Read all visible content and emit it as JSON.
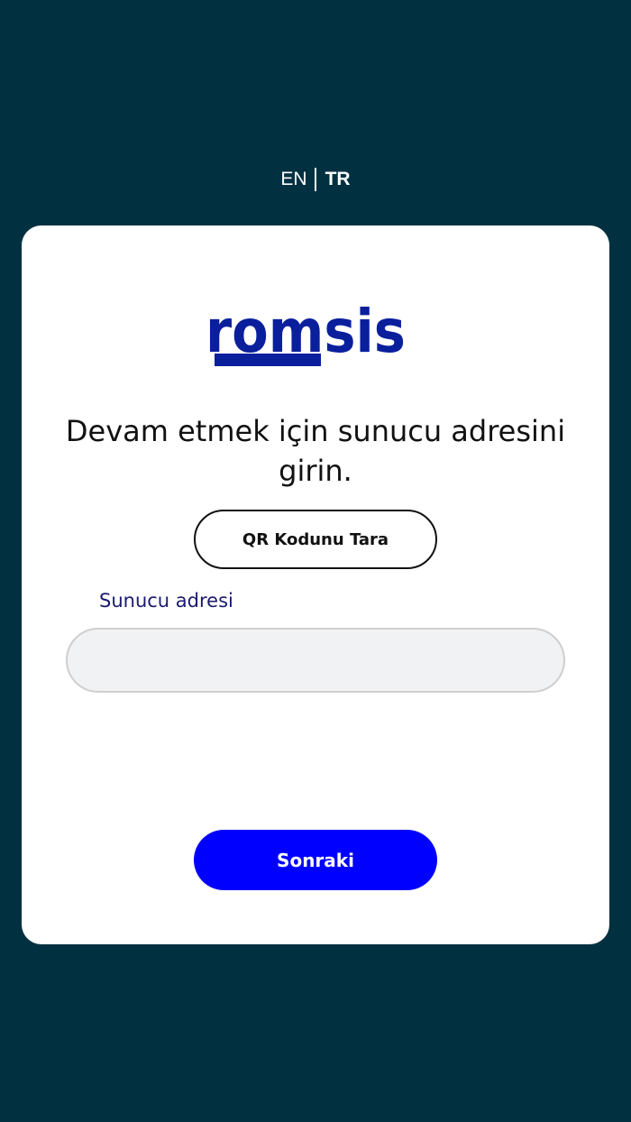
{
  "language_switch": {
    "en_label": "EN",
    "tr_label": "TR",
    "active": "TR"
  },
  "brand": {
    "logo_text": "romsis",
    "color": "#0a1f9c"
  },
  "card": {
    "heading": "Devam etmek için sunucu adresini girin.",
    "qr_button_label": "QR Kodunu Tara",
    "server_field": {
      "label": "Sunucu adresi",
      "value": "",
      "placeholder": ""
    },
    "next_button_label": "Sonraki"
  },
  "colors": {
    "background": "#013141",
    "card": "#ffffff",
    "primary_button": "#0000ff",
    "label": "#1a1a6e"
  }
}
